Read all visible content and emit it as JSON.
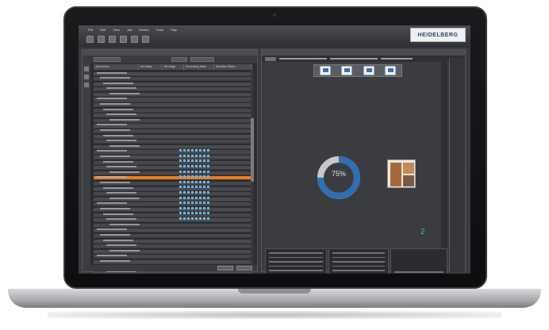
{
  "app": {
    "menu": [
      "File",
      "Edit",
      "View",
      "Job",
      "Device",
      "Tools",
      "Help"
    ],
    "brand": "HEIDELBERG"
  },
  "left_panel": {
    "columns": [
      "Job number",
      "Job Status",
      "Job Stage",
      "Processing State",
      "Workflow Status"
    ],
    "highlighted_row": 20
  },
  "right_panel": {
    "progress_percent": "75%",
    "progress_value": 0.75,
    "job_count": "2"
  },
  "colors": {
    "accent": "#ef7c1a",
    "progress": "#2f6fb2",
    "count": "#47c06a"
  }
}
